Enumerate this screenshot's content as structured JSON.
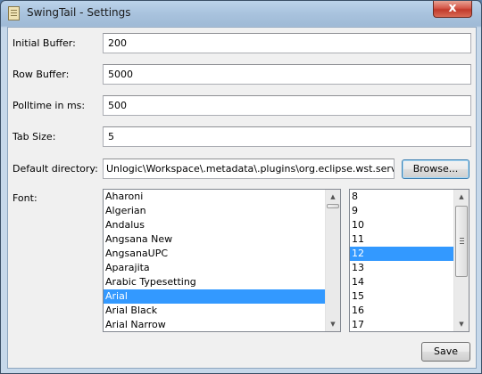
{
  "window": {
    "title": "SwingTail - Settings",
    "close_glyph": "x"
  },
  "form": {
    "initial_buffer": {
      "label": "Initial Buffer:",
      "value": "200"
    },
    "row_buffer": {
      "label": "Row Buffer:",
      "value": "5000"
    },
    "polltime": {
      "label": "Polltime in ms:",
      "value": "500"
    },
    "tab_size": {
      "label": "Tab Size:",
      "value": "5"
    },
    "default_directory": {
      "label": "Default directory:",
      "value": "Unlogic\\Workspace\\.metadata\\.plugins\\org.eclipse.wst.server.core",
      "browse_label": "Browse..."
    },
    "font": {
      "label": "Font:",
      "families": [
        "Aharoni",
        "Algerian",
        "Andalus",
        "Angsana New",
        "AngsanaUPC",
        "Aparajita",
        "Arabic Typesetting",
        "Arial",
        "Arial Black",
        "Arial Narrow"
      ],
      "selected_family": "Arial",
      "sizes": [
        "8",
        "9",
        "10",
        "11",
        "12",
        "13",
        "14",
        "15",
        "16",
        "17"
      ],
      "selected_size": "12"
    }
  },
  "buttons": {
    "save_label": "Save"
  },
  "icons": {
    "app": "document-icon",
    "close": "close-icon",
    "scroll_up": "arrow-up-icon",
    "scroll_down": "arrow-down-icon"
  },
  "colors": {
    "selection": "#3399ff",
    "close_button": "#c13a2c"
  }
}
